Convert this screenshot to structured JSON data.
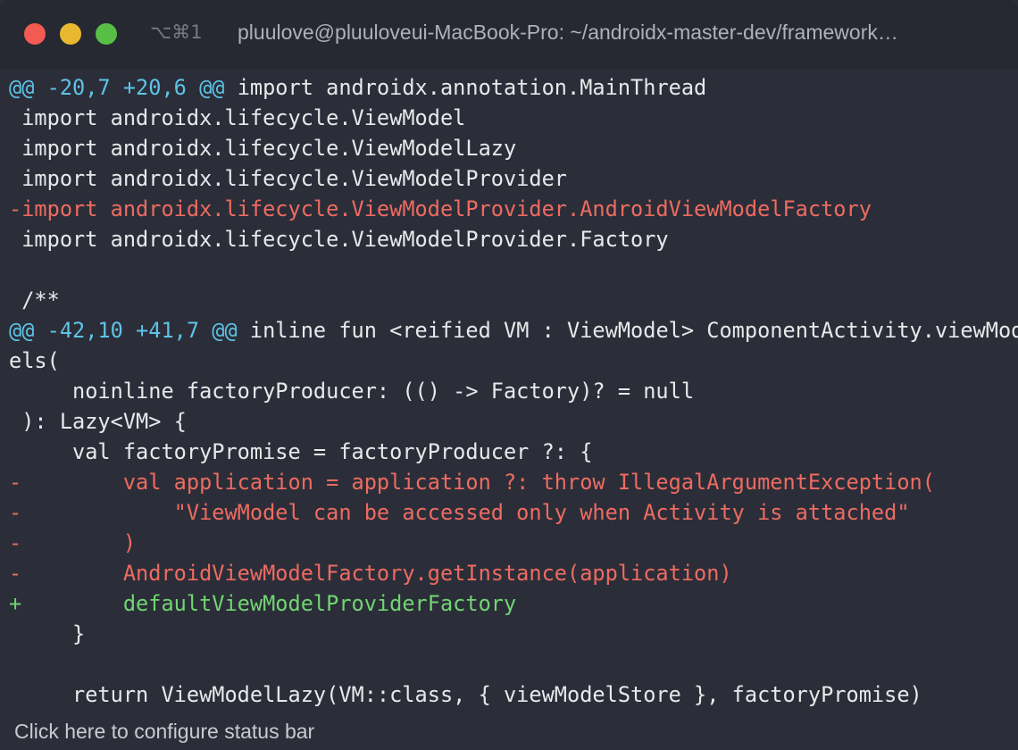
{
  "window": {
    "shortcut": "⌥⌘1",
    "title": "pluulove@pluuloveui-MacBook-Pro: ~/androidx-master-dev/framework…"
  },
  "terminal": {
    "lines": [
      {
        "kind": "hunk",
        "marker": "@@ -20,7 +20,6 @@",
        "text": " import androidx.annotation.MainThread"
      },
      {
        "kind": "context",
        "text": " import androidx.lifecycle.ViewModel"
      },
      {
        "kind": "context",
        "text": " import androidx.lifecycle.ViewModelLazy"
      },
      {
        "kind": "context",
        "text": " import androidx.lifecycle.ViewModelProvider"
      },
      {
        "kind": "deleted",
        "text": "-import androidx.lifecycle.ViewModelProvider.AndroidViewModelFactory"
      },
      {
        "kind": "context",
        "text": " import androidx.lifecycle.ViewModelProvider.Factory"
      },
      {
        "kind": "context",
        "text": ""
      },
      {
        "kind": "context",
        "text": " /**"
      },
      {
        "kind": "hunk",
        "marker": "@@ -42,10 +41,7 @@",
        "text": " inline fun <reified VM : ViewModel> ComponentActivity.viewMod"
      },
      {
        "kind": "context",
        "text": "els("
      },
      {
        "kind": "context",
        "text": "     noinline factoryProducer: (() -> Factory)? = null"
      },
      {
        "kind": "context",
        "text": " ): Lazy<VM> {"
      },
      {
        "kind": "context",
        "text": "     val factoryPromise = factoryProducer ?: {"
      },
      {
        "kind": "deleted",
        "text": "-        val application = application ?: throw IllegalArgumentException("
      },
      {
        "kind": "deleted",
        "text": "-            \"ViewModel can be accessed only when Activity is attached\""
      },
      {
        "kind": "deleted",
        "text": "-        )"
      },
      {
        "kind": "deleted",
        "text": "-        AndroidViewModelFactory.getInstance(application)"
      },
      {
        "kind": "added",
        "text": "+        defaultViewModelProviderFactory"
      },
      {
        "kind": "context",
        "text": "     }"
      },
      {
        "kind": "context",
        "text": ""
      },
      {
        "kind": "context",
        "text": "     return ViewModelLazy(VM::class, { viewModelStore }, factoryPromise)"
      }
    ]
  },
  "statusbar": {
    "text": "Click here to configure status bar"
  },
  "colors": {
    "background": "#2b2e39",
    "hunk_marker": "#5ec3e6",
    "deleted": "#ee6b61",
    "added": "#72d572",
    "context": "#e8e8ea"
  },
  "icons": [
    "close-button",
    "minimize-button",
    "maximize-button"
  ]
}
